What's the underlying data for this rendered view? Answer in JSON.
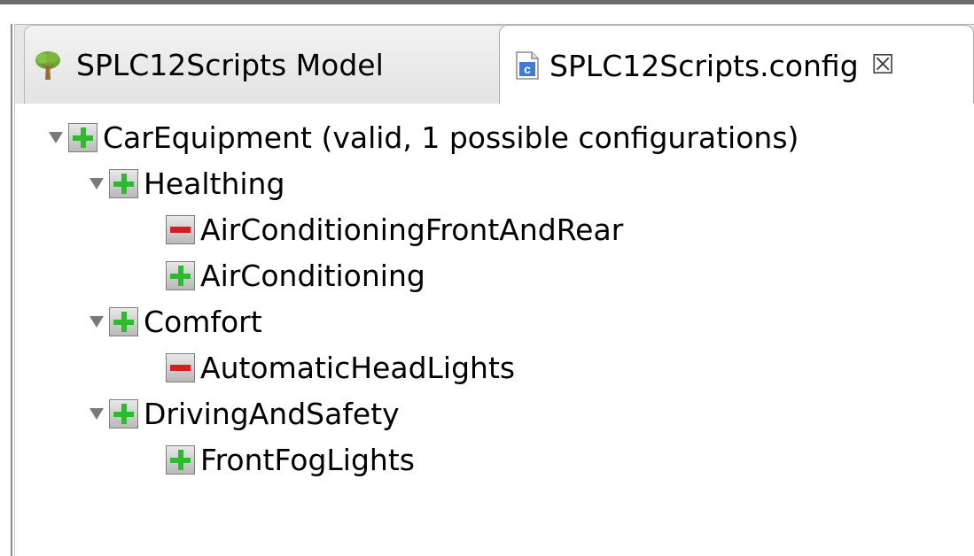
{
  "tabs": [
    {
      "label": "SPLC12Scripts Model",
      "icon": "tree-icon",
      "active": false
    },
    {
      "label": "SPLC12Scripts.config",
      "icon": "config-file-icon",
      "active": true,
      "close_icon": "close-icon"
    }
  ],
  "tree": {
    "root": {
      "label": "CarEquipment (valid, 1 possible configurations)",
      "state": "selected",
      "expanded": true
    },
    "groups": [
      {
        "label": "Healthing",
        "state": "selected",
        "expanded": true,
        "children": [
          {
            "label": "AirConditioningFrontAndRear",
            "state": "deselected"
          },
          {
            "label": "AirConditioning",
            "state": "selected"
          }
        ]
      },
      {
        "label": "Comfort",
        "state": "selected",
        "expanded": true,
        "children": [
          {
            "label": "AutomaticHeadLights",
            "state": "deselected"
          }
        ]
      },
      {
        "label": "DrivingAndSafety",
        "state": "selected",
        "expanded": true,
        "children": [
          {
            "label": "FrontFogLights",
            "state": "selected"
          }
        ]
      }
    ]
  },
  "colors": {
    "selected": "#2dbb2d",
    "deselected": "#d61e1e"
  }
}
